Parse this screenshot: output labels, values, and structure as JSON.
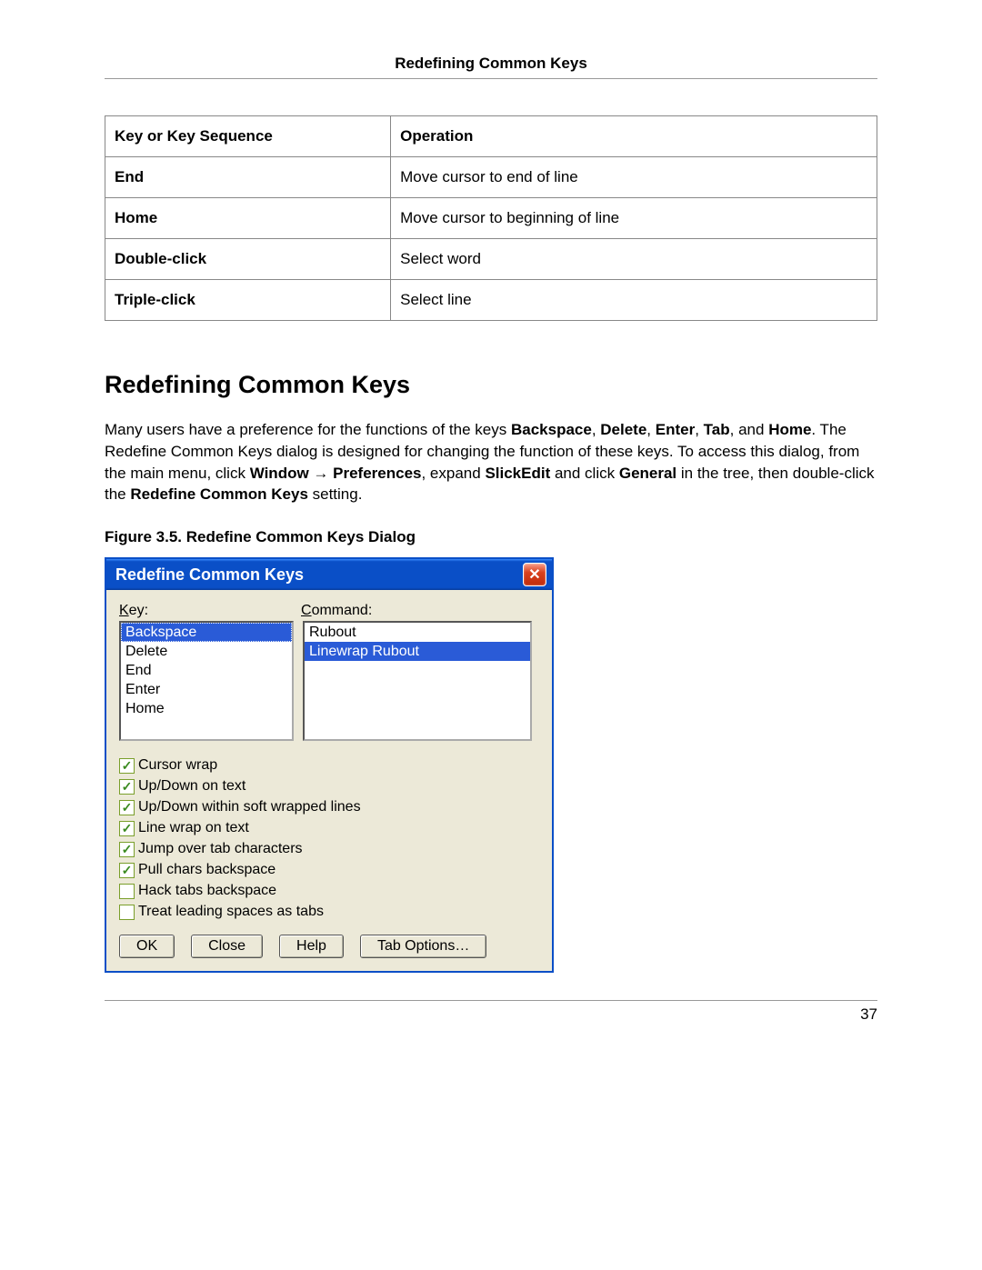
{
  "header": {
    "title": "Redefining Common Keys"
  },
  "table": {
    "headers": {
      "col1": "Key or Key Sequence",
      "col2": "Operation"
    },
    "rows": [
      {
        "key": "End",
        "op": "Move cursor to end of line"
      },
      {
        "key": "Home",
        "op": "Move cursor to beginning of line"
      },
      {
        "key": "Double-click",
        "op": "Select word"
      },
      {
        "key": "Triple-click",
        "op": "Select line"
      }
    ]
  },
  "section": {
    "heading": "Redefining Common Keys"
  },
  "paragraph": {
    "p1a": "Many users have a preference for the functions of the keys ",
    "bold1": "Backspace",
    "sep1": ", ",
    "bold2": "Delete",
    "sep2": ", ",
    "bold3": "Enter",
    "sep3": ", ",
    "bold4": "Tab",
    "sep4": ", and ",
    "bold5": "Home",
    "p1b": ". The Redefine Common Keys dialog is designed for changing the function of these keys. To access this dialog, from the main menu, click ",
    "bold6": "Window",
    "arrow": " → ",
    "bold7": "Preferences",
    "p1c": ", expand ",
    "bold8": "SlickEdit",
    "p1d": " and click ",
    "bold9": "General",
    "p1e": " in the tree, then double-click the ",
    "bold10": "Redefine Common Keys",
    "p1f": " setting."
  },
  "figure": {
    "caption": "Figure 3.5. Redefine Common Keys Dialog"
  },
  "dialog": {
    "title": "Redefine Common Keys",
    "labels": {
      "key": "Key:",
      "command": "Command:"
    },
    "keyList": [
      "Backspace",
      "Delete",
      "End",
      "Enter",
      "Home"
    ],
    "keySelectedIndex": 0,
    "commandList": [
      "Rubout",
      "Linewrap Rubout"
    ],
    "commandSelectedIndex": 1,
    "checkboxes": [
      {
        "label": "Cursor wrap",
        "checked": true
      },
      {
        "label": "Up/Down on text",
        "checked": true
      },
      {
        "label": "Up/Down within soft wrapped lines",
        "checked": true
      },
      {
        "label": "Line wrap on text",
        "checked": true
      },
      {
        "label": "Jump over tab characters",
        "checked": true
      },
      {
        "label": "Pull chars backspace",
        "checked": true
      },
      {
        "label": "Hack tabs backspace",
        "checked": false
      },
      {
        "label": "Treat leading spaces as tabs",
        "checked": false
      }
    ],
    "buttons": {
      "ok": "OK",
      "close": "Close",
      "help": "Help",
      "tabopts": "Tab Options…"
    }
  },
  "pageNumber": "37"
}
